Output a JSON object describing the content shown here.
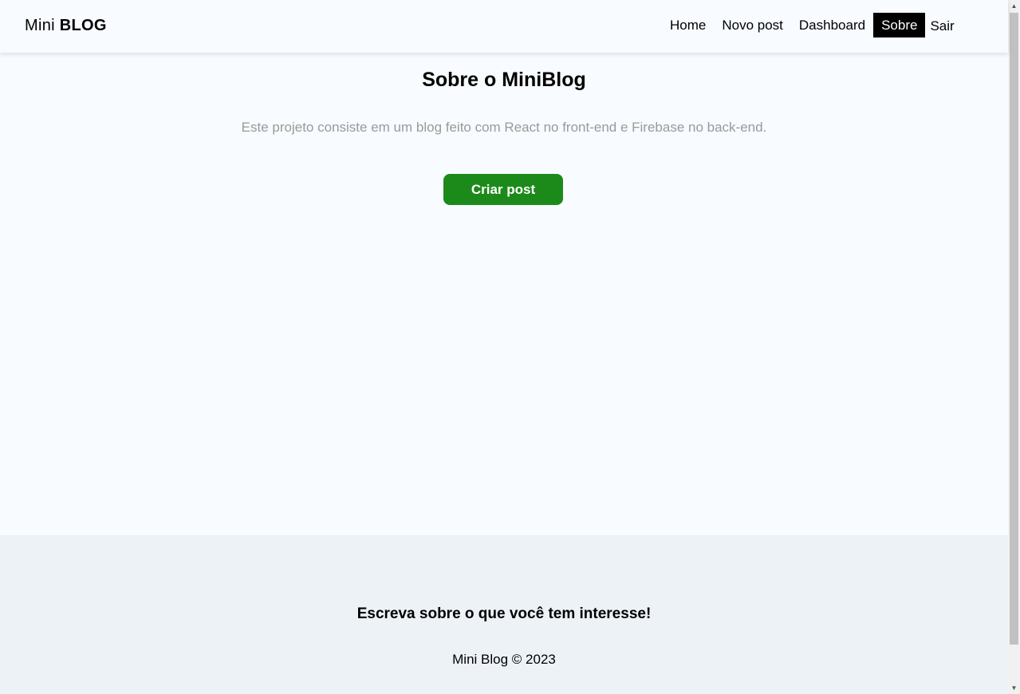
{
  "navbar": {
    "brand_light": "Mini",
    "brand_bold": "BLOG",
    "links": [
      {
        "label": "Home"
      },
      {
        "label": "Novo post"
      },
      {
        "label": "Dashboard"
      },
      {
        "label": "Sobre",
        "active": true
      }
    ],
    "exit_label": "Sair"
  },
  "main": {
    "title": "Sobre o MiniBlog",
    "description": "Este projeto consiste em um blog feito com React no front-end e Firebase no back-end.",
    "cta_label": "Criar post"
  },
  "footer": {
    "title": "Escreva sobre o que você tem interesse!",
    "copyright": "Mini Blog © 2023"
  },
  "colors": {
    "background": "#f8fbff",
    "accent": "#1c8a1a",
    "footer_bg": "#edf2f7",
    "muted_text": "#9a9a9a"
  },
  "scrollbar": {
    "up_icon": "scroll-up-arrow-icon",
    "down_icon": "scroll-down-arrow-icon"
  }
}
